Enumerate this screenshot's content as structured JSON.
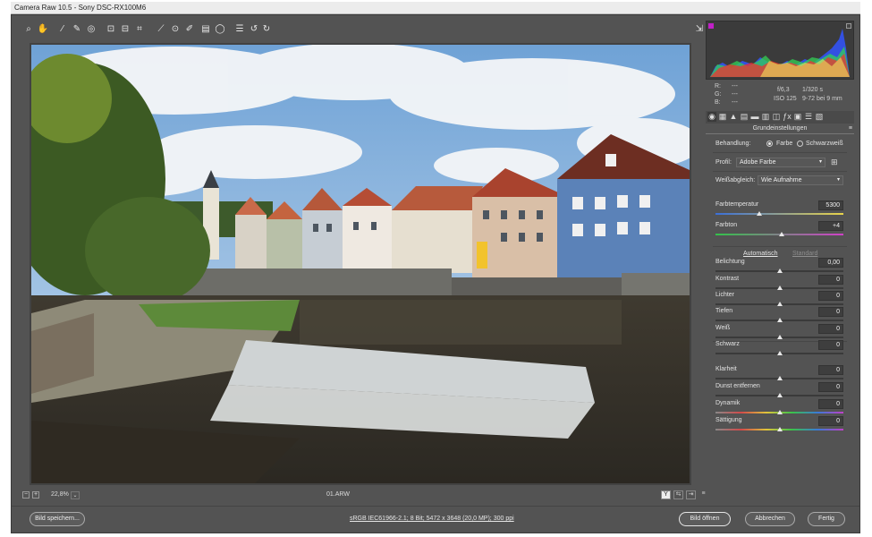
{
  "window": {
    "title": "Camera Raw 10.5 - Sony DSC-RX100M6"
  },
  "toolbar": {
    "tools": [
      "zoom-tool",
      "hand-tool",
      "white-balance-tool",
      "color-sampler-tool",
      "targeted-adjustment-tool",
      "crop-tool",
      "straighten-tool",
      "transform-tool",
      "spot-removal-tool",
      "red-eye-tool",
      "adjustment-brush-tool",
      "graduated-filter-tool",
      "radial-filter-tool",
      "presets-menu",
      "rotate-ccw",
      "rotate-cw"
    ],
    "fullscreen_icon": "fullscreen-icon"
  },
  "status": {
    "zoom": "22,8%",
    "filename": "01.ARW"
  },
  "histogram": {
    "r_label": "R:",
    "r_value": "---",
    "g_label": "G:",
    "g_value": "---",
    "b_label": "B:",
    "b_value": "---",
    "aperture": "f/6,3",
    "shutter": "1/320 s",
    "iso": "ISO 125",
    "lens": "9-72 bei 9 mm"
  },
  "panel": {
    "title": "Grundeinstellungen",
    "treatment_label": "Behandlung:",
    "treatment_color": "Farbe",
    "treatment_bw": "Schwarzweiß",
    "profile_label": "Profil:",
    "profile_value": "Adobe Farbe",
    "wb_label": "Weißabgleich:",
    "wb_value": "Wie Aufnahme",
    "auto_label": "Automatisch",
    "default_label": "Standard",
    "sliders": [
      {
        "label": "Farbtemperatur",
        "value": "5300",
        "pos": 0.34,
        "gradient": "temp"
      },
      {
        "label": "Farbton",
        "value": "+4",
        "pos": 0.52,
        "gradient": "tint"
      },
      {
        "label": "Belichtung",
        "value": "0,00",
        "pos": 0.5,
        "gradient": "none"
      },
      {
        "label": "Kontrast",
        "value": "0",
        "pos": 0.5,
        "gradient": "none"
      },
      {
        "label": "Lichter",
        "value": "0",
        "pos": 0.5,
        "gradient": "none"
      },
      {
        "label": "Tiefen",
        "value": "0",
        "pos": 0.5,
        "gradient": "none"
      },
      {
        "label": "Weiß",
        "value": "0",
        "pos": 0.5,
        "gradient": "none"
      },
      {
        "label": "Schwarz",
        "value": "0",
        "pos": 0.5,
        "gradient": "none"
      },
      {
        "label": "Klarheit",
        "value": "0",
        "pos": 0.5,
        "gradient": "none"
      },
      {
        "label": "Dunst entfernen",
        "value": "0",
        "pos": 0.5,
        "gradient": "none"
      },
      {
        "label": "Dynamik",
        "value": "0",
        "pos": 0.5,
        "gradient": "sat"
      },
      {
        "label": "Sättigung",
        "value": "0",
        "pos": 0.5,
        "gradient": "sat"
      }
    ]
  },
  "footer": {
    "save_button": "Bild speichern...",
    "workflow_link": "sRGB IEC61966-2.1; 8 Bit; 5472 x 3648 (20,0 MP); 300 ppi",
    "open_button": "Bild öffnen",
    "cancel_button": "Abbrechen",
    "done_button": "Fertig"
  },
  "colors": {
    "window_bg": "#535353",
    "panel_bg": "#535353",
    "histogram_bg": "#3b3b3b"
  }
}
